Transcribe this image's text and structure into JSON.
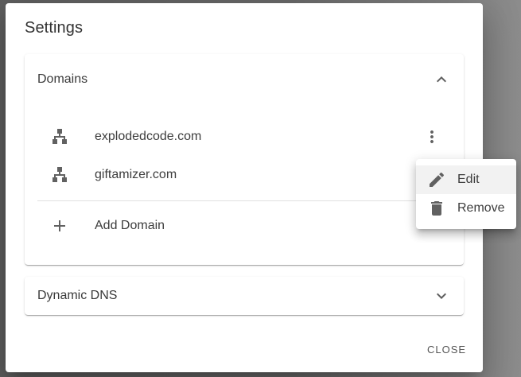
{
  "dialog": {
    "title": "Settings",
    "close_label": "CLOSE"
  },
  "domains_panel": {
    "title": "Domains",
    "expanded": true,
    "items": [
      {
        "label": "explodedcode.com",
        "icon": "sitemap-icon"
      },
      {
        "label": "giftamizer.com",
        "icon": "sitemap-icon"
      }
    ],
    "add_label": "Add Domain"
  },
  "ddns_panel": {
    "title": "Dynamic DNS",
    "expanded": false
  },
  "context_menu": {
    "items": [
      {
        "label": "Edit",
        "icon": "pencil-icon"
      },
      {
        "label": "Remove",
        "icon": "trash-icon"
      }
    ]
  },
  "colors": {
    "icon": "#616161",
    "text": "#3d3d3d",
    "backdrop": "#666666"
  }
}
